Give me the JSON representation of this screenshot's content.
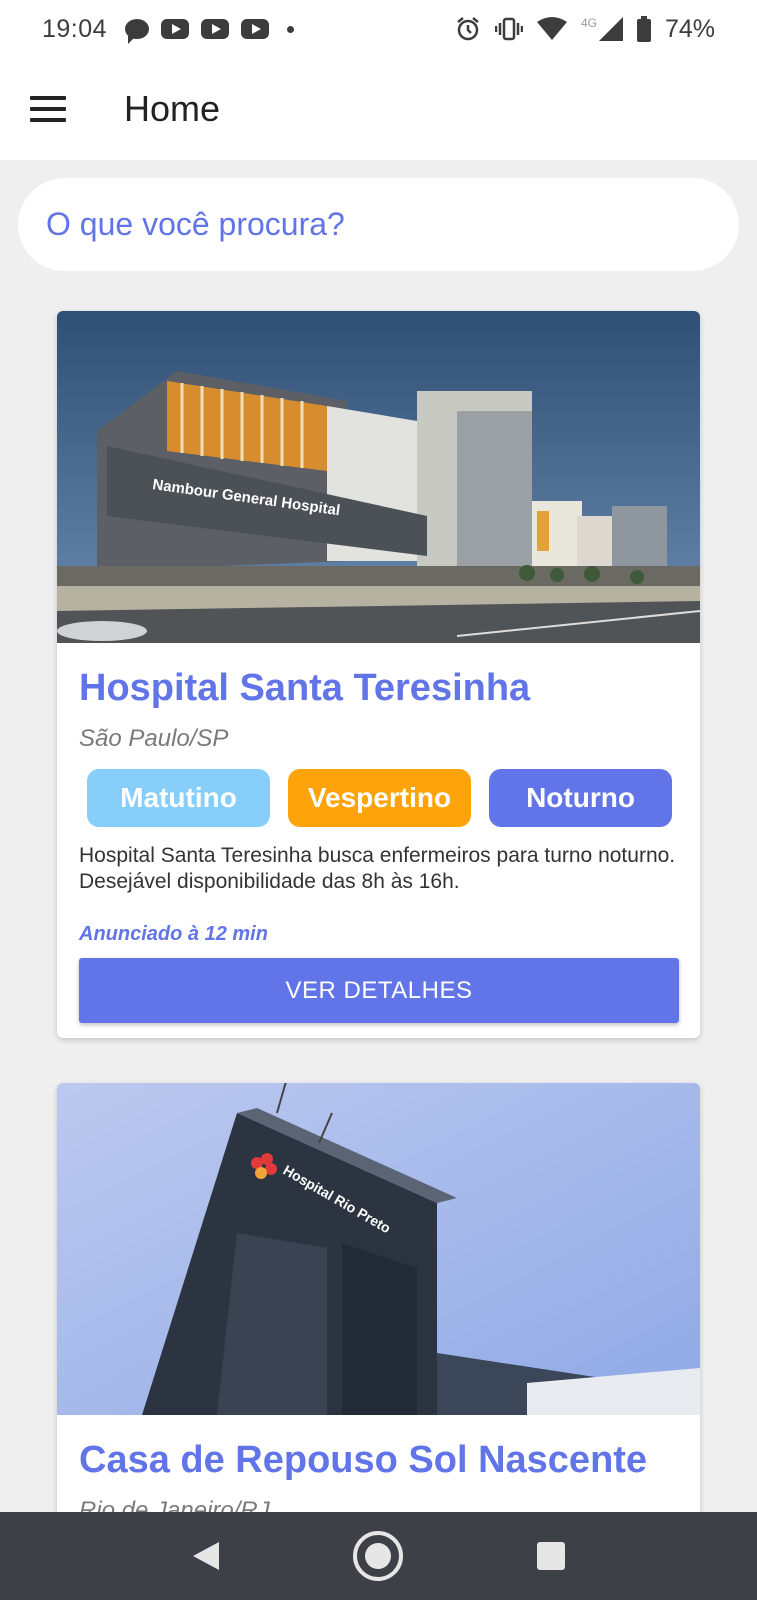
{
  "status_bar": {
    "time": "19:04",
    "network": "4G",
    "battery": "74%",
    "icons": [
      "messenger-icon",
      "youtube-icon",
      "youtube-icon",
      "youtube-icon",
      "dot-icon",
      "alarm-icon",
      "vibrate-icon",
      "wifi-icon",
      "signal-icon",
      "battery-icon"
    ]
  },
  "app_bar": {
    "title": "Home",
    "menu_icon": "menu-icon"
  },
  "search": {
    "placeholder": "O que você procura?"
  },
  "cards": [
    {
      "title": "Hospital Santa Teresinha",
      "location": "São Paulo/SP",
      "image_sign_text": "Nambour General Hospital",
      "shifts": [
        "Matutino",
        "Vespertino",
        "Noturno"
      ],
      "description": "Hospital Santa Teresinha busca enfermeiros para turno noturno. Desejável disponibilidade das 8h às 16h.",
      "posted": "Anunciado à 12 min",
      "button": "VER DETALHES"
    },
    {
      "title": "Casa de Repouso Sol Nascente",
      "location": "Rio de Janeiro/RJ",
      "image_sign_text": "Hospital Rio Preto"
    }
  ],
  "nav_bar": {
    "icons": [
      "back-icon",
      "home-icon",
      "recents-icon"
    ]
  },
  "colors": {
    "accent": "#6175e8",
    "matutino": "#87cefa",
    "vespertino": "#ffa30a",
    "noturno": "#6175e8",
    "background": "#efefef",
    "nav_bar": "#3d4147"
  }
}
